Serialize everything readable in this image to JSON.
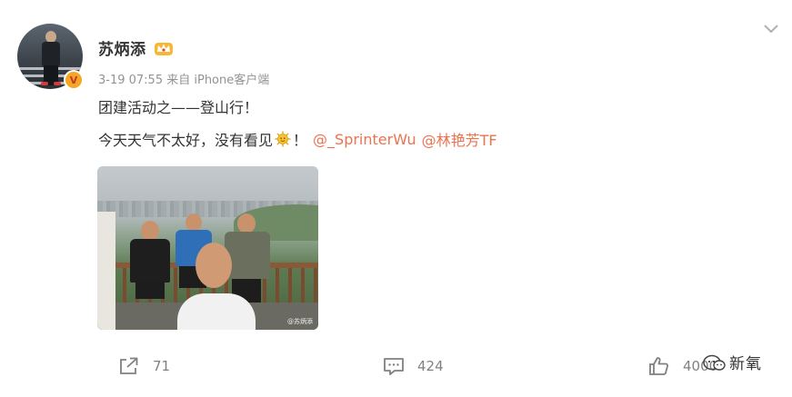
{
  "post": {
    "username": "苏炳添",
    "verified_badge": "V",
    "meta": "3-19 07:55  来自 iPhone客户端",
    "line1": "团建活动之——登山行！",
    "line2_before": "今天天气不太好，没有看见",
    "line2_after": "！",
    "mentions": [
      "@_SprinterWu",
      "@林艳芳TF"
    ],
    "image_watermark": "@苏炳添"
  },
  "actions": {
    "share_count": "71",
    "comment_count": "424",
    "like_count": "4000"
  },
  "watermark": {
    "brand_name": "新氧"
  },
  "colors": {
    "mention": "#eb7350",
    "meta": "#939393",
    "action": "#808080",
    "badge": "#f5a623"
  },
  "icons": [
    "more-dots-icon",
    "crown-icon",
    "sun-emoji-icon",
    "share-icon",
    "comment-icon",
    "like-icon",
    "brand-logo-icon"
  ]
}
